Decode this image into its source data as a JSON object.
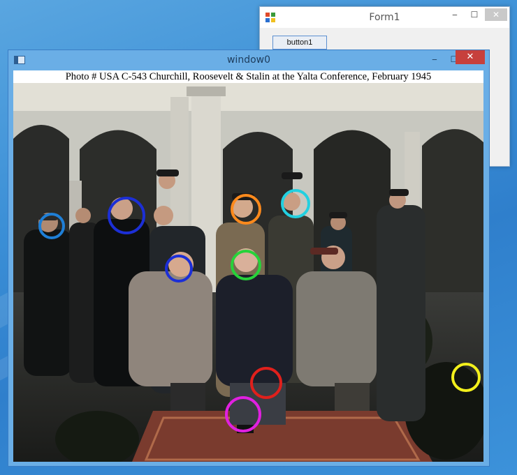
{
  "form1": {
    "title": "Form1",
    "button_label": "button1"
  },
  "window0": {
    "title": "window0",
    "caption": "Photo #  USA C-543    Churchill, Roosevelt & Stalin at the Yalta Conference, February 1945"
  },
  "controls": {
    "minimize": "‒",
    "maximize": "☐",
    "close": "✕"
  },
  "markers": [
    {
      "name": "marker-blue-left",
      "color": "#1f7fd6"
    },
    {
      "name": "marker-blue-large",
      "color": "#1c2fd6"
    },
    {
      "name": "marker-blue-small",
      "color": "#1c2fd6"
    },
    {
      "name": "marker-orange",
      "color": "#ff8a1c"
    },
    {
      "name": "marker-cyan",
      "color": "#22d0e0"
    },
    {
      "name": "marker-green",
      "color": "#27d23a"
    },
    {
      "name": "marker-red",
      "color": "#e0201c"
    },
    {
      "name": "marker-magenta",
      "color": "#e020e0"
    },
    {
      "name": "marker-yellow",
      "color": "#f3f01c"
    }
  ]
}
